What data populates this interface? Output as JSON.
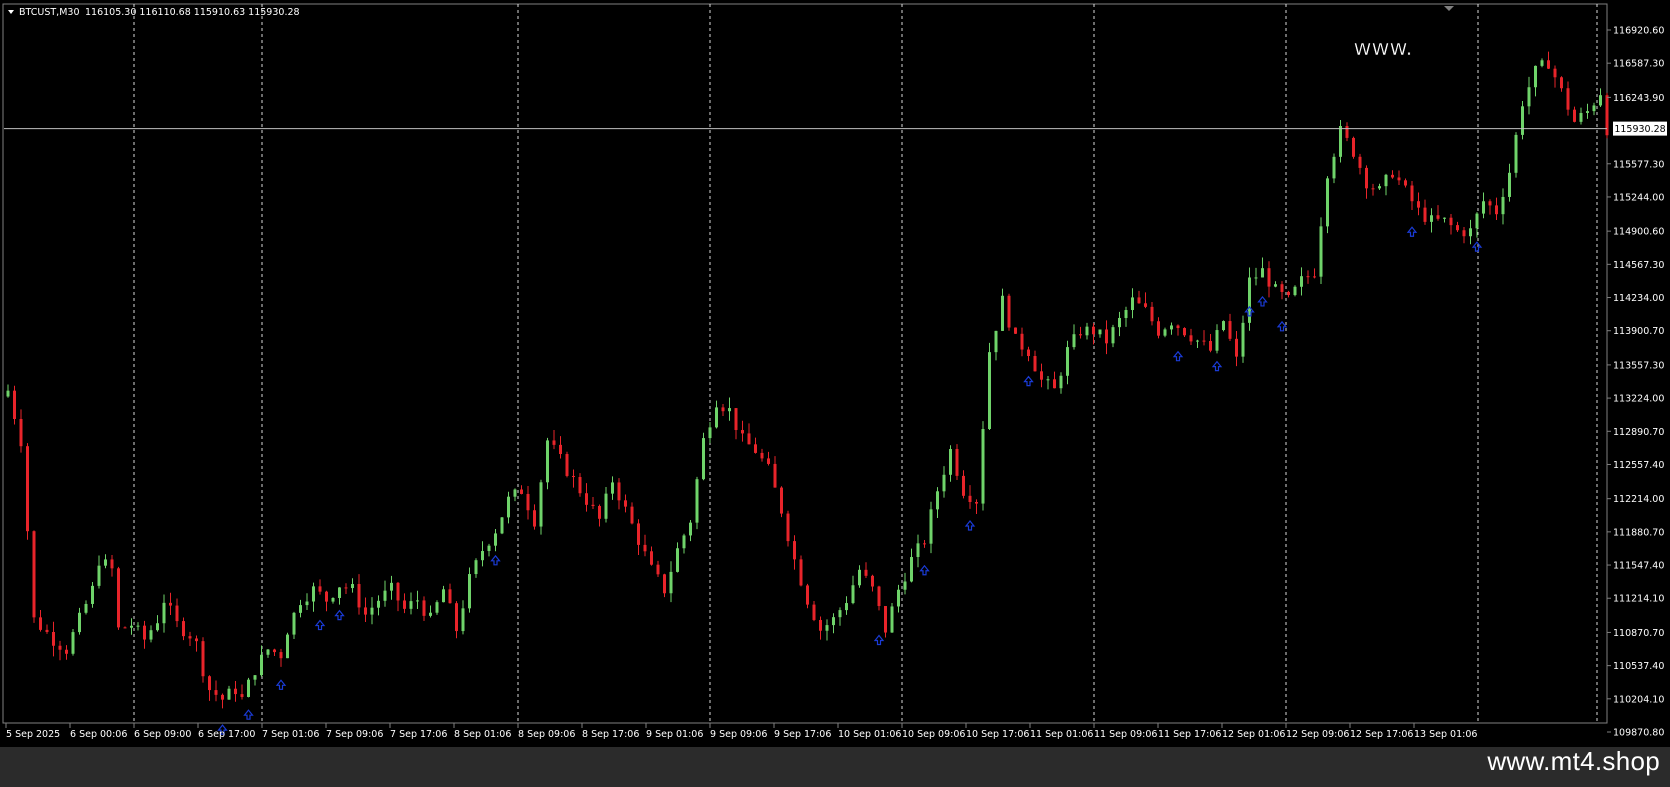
{
  "header": {
    "symbol_timeframe": "BTCUST,M30",
    "ohlc": "116105.30 116110.68 115910.63 115930.28"
  },
  "overlay_text": "www.",
  "watermark": "www.mt4.shop",
  "colors": {
    "background": "#000000",
    "bull": "#6fd36a",
    "bear": "#e8242a",
    "grid": "#ffffff",
    "arrow": "#1a3bd6",
    "axis_text": "#ffffff",
    "price_line": "#c0c0c0"
  },
  "chart_data": {
    "type": "candlestick",
    "current_price": 115930.28,
    "current_price_label": "115930.28",
    "ylim": [
      109870.8,
      117100.0
    ],
    "grid": "vertical-dashed",
    "y_ticks": [
      "116920.60",
      "116587.30",
      "116243.90",
      "115577.30",
      "115244.00",
      "114900.60",
      "114567.30",
      "114234.00",
      "113900.70",
      "113557.30",
      "113224.00",
      "112890.70",
      "112557.40",
      "112214.00",
      "111880.70",
      "111547.40",
      "111214.10",
      "110870.70",
      "110537.40",
      "110204.10",
      "109870.80"
    ],
    "x_ticks": [
      "5 Sep 2025",
      "6 Sep 00:06",
      "6 Sep 09:00",
      "6 Sep 17:00",
      "7 Sep 01:06",
      "7 Sep 09:06",
      "7 Sep 17:06",
      "8 Sep 01:06",
      "8 Sep 09:06",
      "8 Sep 17:06",
      "9 Sep 01:06",
      "9 Sep 09:06",
      "9 Sep 17:06",
      "10 Sep 01:06",
      "10 Sep 09:06",
      "10 Sep 17:06",
      "11 Sep 01:06",
      "11 Sep 09:06",
      "11 Sep 17:06",
      "12 Sep 01:06",
      "12 Sep 09:06",
      "12 Sep 17:06",
      "13 Sep 01:06"
    ],
    "vertical_gridlines_at": [
      "6 Sep 00:06",
      "6 Sep 17:00",
      "8 Sep 01:06",
      "9 Sep 01:06",
      "10 Sep 01:06",
      "11 Sep 01:06",
      "12 Sep 01:06",
      "13 Sep 01:06"
    ],
    "close_path": [
      [
        1,
        113300
      ],
      [
        3,
        112800
      ],
      [
        5,
        111000
      ],
      [
        8,
        110800
      ],
      [
        10,
        110700
      ],
      [
        12,
        111000
      ],
      [
        14,
        111300
      ],
      [
        15,
        111600
      ],
      [
        17,
        111500
      ],
      [
        18,
        110900
      ],
      [
        20,
        110950
      ],
      [
        22,
        110800
      ],
      [
        24,
        111000
      ],
      [
        25,
        111200
      ],
      [
        27,
        110950
      ],
      [
        29,
        110850
      ],
      [
        30,
        110750
      ],
      [
        31,
        110500
      ],
      [
        32,
        110300
      ],
      [
        34,
        110200
      ],
      [
        35,
        110250
      ],
      [
        36,
        110300
      ],
      [
        37,
        110200
      ],
      [
        38,
        110350
      ],
      [
        39,
        110500
      ],
      [
        40,
        110600
      ],
      [
        41,
        110700
      ],
      [
        43,
        110650
      ],
      [
        44,
        110900
      ],
      [
        46,
        111200
      ],
      [
        48,
        111300
      ],
      [
        50,
        111200
      ],
      [
        52,
        111350
      ],
      [
        54,
        111300
      ],
      [
        56,
        111050
      ],
      [
        58,
        111200
      ],
      [
        60,
        111300
      ],
      [
        62,
        111100
      ],
      [
        64,
        111200
      ],
      [
        66,
        111000
      ],
      [
        68,
        111300
      ],
      [
        70,
        110900
      ],
      [
        72,
        111400
      ],
      [
        74,
        111700
      ],
      [
        76,
        111900
      ],
      [
        78,
        112200
      ],
      [
        80,
        112300
      ],
      [
        82,
        112000
      ],
      [
        84,
        112800
      ],
      [
        86,
        112600
      ],
      [
        88,
        112400
      ],
      [
        90,
        112200
      ],
      [
        92,
        112000
      ],
      [
        94,
        112400
      ],
      [
        96,
        112100
      ],
      [
        98,
        111800
      ],
      [
        100,
        111500
      ],
      [
        102,
        111300
      ],
      [
        104,
        111700
      ],
      [
        106,
        112000
      ],
      [
        108,
        112800
      ],
      [
        110,
        113200
      ],
      [
        112,
        113100
      ],
      [
        114,
        112800
      ],
      [
        116,
        112700
      ],
      [
        118,
        112500
      ],
      [
        120,
        112100
      ],
      [
        122,
        111600
      ],
      [
        124,
        111200
      ],
      [
        126,
        110900
      ],
      [
        128,
        111000
      ],
      [
        130,
        111200
      ],
      [
        132,
        111500
      ],
      [
        134,
        111300
      ],
      [
        136,
        110900
      ],
      [
        138,
        111300
      ],
      [
        140,
        111600
      ],
      [
        142,
        111800
      ],
      [
        144,
        112300
      ],
      [
        146,
        112700
      ],
      [
        148,
        112300
      ],
      [
        150,
        112200
      ],
      [
        152,
        113700
      ],
      [
        154,
        114200
      ],
      [
        156,
        113800
      ],
      [
        158,
        113700
      ],
      [
        160,
        113400
      ],
      [
        162,
        113300
      ],
      [
        164,
        113700
      ],
      [
        166,
        113900
      ],
      [
        168,
        113900
      ],
      [
        170,
        113800
      ],
      [
        172,
        114000
      ],
      [
        174,
        114200
      ],
      [
        176,
        114100
      ],
      [
        178,
        113900
      ],
      [
        180,
        114000
      ],
      [
        182,
        113900
      ],
      [
        184,
        113800
      ],
      [
        186,
        113700
      ],
      [
        188,
        114000
      ],
      [
        190,
        113600
      ],
      [
        192,
        114400
      ],
      [
        194,
        114500
      ],
      [
        196,
        114300
      ],
      [
        198,
        114200
      ],
      [
        200,
        114400
      ],
      [
        202,
        114500
      ],
      [
        204,
        115500
      ],
      [
        206,
        115900
      ],
      [
        208,
        115700
      ],
      [
        210,
        115400
      ],
      [
        212,
        115300
      ],
      [
        214,
        115500
      ],
      [
        216,
        115300
      ],
      [
        218,
        115100
      ],
      [
        220,
        115000
      ],
      [
        222,
        115000
      ],
      [
        224,
        114900
      ],
      [
        226,
        114900
      ],
      [
        228,
        115200
      ],
      [
        230,
        115100
      ],
      [
        232,
        115500
      ],
      [
        234,
        116200
      ],
      [
        236,
        116500
      ],
      [
        238,
        116600
      ],
      [
        240,
        116300
      ],
      [
        242,
        116000
      ],
      [
        244,
        116100
      ],
      [
        246,
        116300
      ],
      [
        247,
        115930
      ]
    ],
    "buy_arrows_at_bar": [
      33,
      37,
      42,
      48,
      51,
      75,
      134,
      141,
      148,
      157,
      180,
      186,
      191,
      193,
      196,
      216,
      226
    ]
  }
}
